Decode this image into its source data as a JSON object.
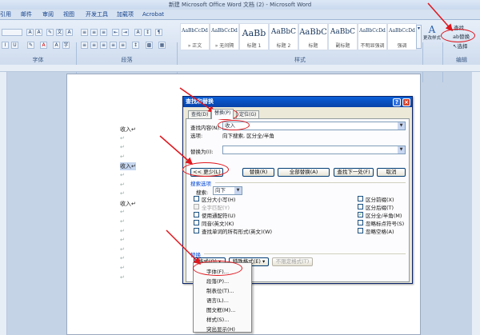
{
  "window": {
    "title": "新建 Microsoft Office Word 文档 (2) - Microsoft Word"
  },
  "ribbon_tabs": [
    "引用",
    "邮件",
    "审阅",
    "视图",
    "开发工具",
    "加载项",
    "Acrobat"
  ],
  "ribbon": {
    "font_group_label": "字体",
    "paragraph_group_label": "段落",
    "styles_group_label": "样式",
    "editing_group_label": "编辑",
    "styles": [
      {
        "sample": "AaBbCcDd",
        "name": "» 正文"
      },
      {
        "sample": "AaBbCcDd",
        "name": "» 无间隔"
      },
      {
        "sample": "AaBb",
        "name": "标题 1"
      },
      {
        "sample": "AaBbC",
        "name": "标题 2"
      },
      {
        "sample": "AaBbC",
        "name": "标题"
      },
      {
        "sample": "AaBbC",
        "name": "副标题"
      },
      {
        "sample": "AaBbCcDd",
        "name": "不明显强调"
      },
      {
        "sample": "AaBbCcDd",
        "name": "强调"
      }
    ],
    "change_styles": "更改样式",
    "find": "查找",
    "replace": "替换",
    "select": "选择"
  },
  "document": {
    "lines": [
      {
        "text": "收入↵",
        "highlight": false
      },
      {
        "text": "↵",
        "highlight": false
      },
      {
        "text": "↵",
        "highlight": false
      },
      {
        "text": "↵",
        "highlight": false
      },
      {
        "text": "收入↵",
        "highlight": true
      },
      {
        "text": "↵",
        "highlight": false
      },
      {
        "text": "↵",
        "highlight": false
      },
      {
        "text": "↵",
        "highlight": false
      },
      {
        "text": "收入↵",
        "highlight": false
      },
      {
        "text": "↵",
        "highlight": false
      },
      {
        "text": "↵",
        "highlight": false
      },
      {
        "text": "↵",
        "highlight": false
      },
      {
        "text": "↵",
        "highlight": false
      },
      {
        "text": "↵",
        "highlight": false
      },
      {
        "text": "↵",
        "highlight": false
      },
      {
        "text": "↵",
        "highlight": false
      },
      {
        "text": "↵",
        "highlight": false
      }
    ]
  },
  "dialog": {
    "title": "查找和替换",
    "tabs": [
      "查找(D)",
      "替换(P)",
      "定位(G)"
    ],
    "find_label": "查找内容(N):",
    "find_value": "收入",
    "options_label": "选项:",
    "options_value": "向下搜索, 区分全/半角",
    "replace_label": "替换为(I):",
    "replace_value": "",
    "buttons": {
      "less": "<< 更少(L)",
      "replace": "替换(R)",
      "replace_all": "全部替换(A)",
      "find_next": "查找下一处(F)",
      "cancel": "取消"
    },
    "search_options_label": "搜索选项",
    "search_label": "搜索:",
    "search_value": "向下",
    "checkboxes_left": [
      {
        "label": "区分大小写(H)",
        "checked": false,
        "disabled": false
      },
      {
        "label": "全字匹配(Y)",
        "checked": false,
        "disabled": true
      },
      {
        "label": "使用通配符(U)",
        "checked": false,
        "disabled": false
      },
      {
        "label": "同音(英文)(K)",
        "checked": false,
        "disabled": false
      },
      {
        "label": "查找单词的所有形式(英文)(W)",
        "checked": false,
        "disabled": false
      }
    ],
    "checkboxes_right": [
      {
        "label": "区分前缀(X)",
        "checked": false,
        "disabled": false
      },
      {
        "label": "区分后缀(T)",
        "checked": false,
        "disabled": false
      },
      {
        "label": "区分全/半角(M)",
        "checked": true,
        "disabled": false
      },
      {
        "label": "忽略标点符号(S)",
        "checked": false,
        "disabled": false
      },
      {
        "label": "忽略空格(A)",
        "checked": false,
        "disabled": false
      }
    ],
    "replace_section_label": "替换",
    "format_button": "格式(O) ▾",
    "special_button": "特殊格式(E) ▾",
    "no_format_button": "不限定格式(T)"
  },
  "format_menu": [
    "字体(F)...",
    "段落(P)...",
    "制表位(T)...",
    "语言(L)...",
    "图文框(M)...",
    "样式(S)...",
    "突出显示(H)"
  ],
  "colors": {
    "annotation": "#e0161d",
    "title_bar": "#0a4fc5"
  }
}
